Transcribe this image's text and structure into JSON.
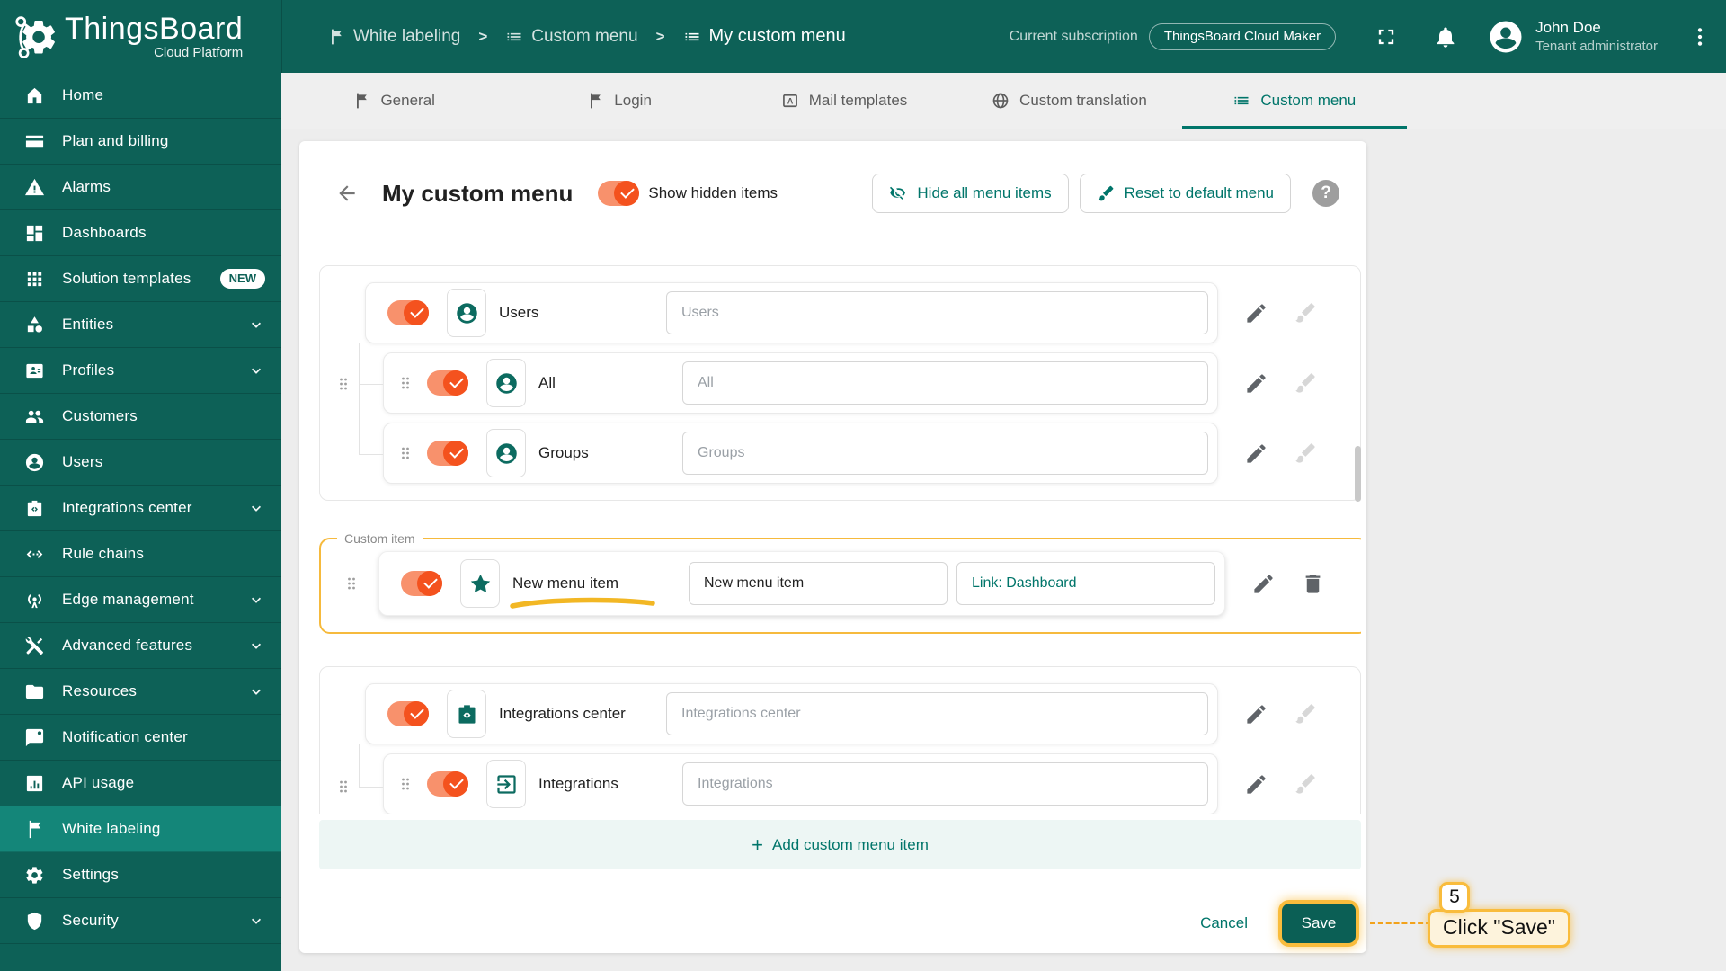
{
  "colors": {
    "header_bg": "#0d6157",
    "active_item_bg": "#148679",
    "accent": "#00756a",
    "save_bg": "#0b5f55",
    "toggle_thumb": "#f4521e",
    "toggle_track": "#f8916c",
    "annotation_yellow": "#f9bc3c",
    "callout_bg": "#fdf3dc"
  },
  "header": {
    "logo_title": "ThingsBoard",
    "logo_subtitle": "Cloud Platform",
    "separator": ">",
    "breadcrumbs": [
      {
        "label": "White labeling"
      },
      {
        "label": "Custom menu"
      },
      {
        "label": "My custom menu"
      }
    ],
    "subscription_label": "Current subscription",
    "subscription_value": "ThingsBoard Cloud Maker",
    "user": {
      "name": "John Doe",
      "role": "Tenant administrator"
    }
  },
  "sidebar": {
    "items": [
      {
        "label": "Home"
      },
      {
        "label": "Plan and billing"
      },
      {
        "label": "Alarms"
      },
      {
        "label": "Dashboards"
      },
      {
        "label": "Solution templates",
        "badge": "NEW"
      },
      {
        "label": "Entities",
        "expandable": true
      },
      {
        "label": "Profiles",
        "expandable": true
      },
      {
        "label": "Customers"
      },
      {
        "label": "Users"
      },
      {
        "label": "Integrations center",
        "expandable": true
      },
      {
        "label": "Rule chains"
      },
      {
        "label": "Edge management",
        "expandable": true
      },
      {
        "label": "Advanced features",
        "expandable": true
      },
      {
        "label": "Resources",
        "expandable": true
      },
      {
        "label": "Notification center"
      },
      {
        "label": "API usage"
      },
      {
        "label": "White labeling",
        "active": true
      },
      {
        "label": "Settings"
      },
      {
        "label": "Security",
        "expandable": true
      }
    ]
  },
  "tabs": [
    {
      "label": "General"
    },
    {
      "label": "Login"
    },
    {
      "label": "Mail templates"
    },
    {
      "label": "Custom translation"
    },
    {
      "label": "Custom menu",
      "active": true
    }
  ],
  "content": {
    "title": "My custom menu",
    "show_hidden_label": "Show hidden items",
    "hide_all_label": "Hide all menu items",
    "reset_label": "Reset to default menu",
    "help_glyph": "?",
    "menu_groups": [
      {
        "parent": {
          "label": "Users",
          "value": "Users"
        },
        "children": [
          {
            "label": "All",
            "value": "All"
          },
          {
            "label": "Groups",
            "value": "Groups"
          }
        ]
      },
      {
        "parent": {
          "label": "Integrations center",
          "value": "Integrations center"
        },
        "children": [
          {
            "label": "Integrations",
            "value": "Integrations"
          }
        ]
      }
    ],
    "custom_item": {
      "legend": "Custom item",
      "label": "New menu item",
      "name_value": "New menu item",
      "link_value": "Link: Dashboard"
    },
    "add_plus": "+",
    "add_label": "Add custom menu item",
    "cancel_label": "Cancel",
    "save_label": "Save"
  },
  "annotation": {
    "step": "5",
    "label": "Click \"Save\""
  }
}
